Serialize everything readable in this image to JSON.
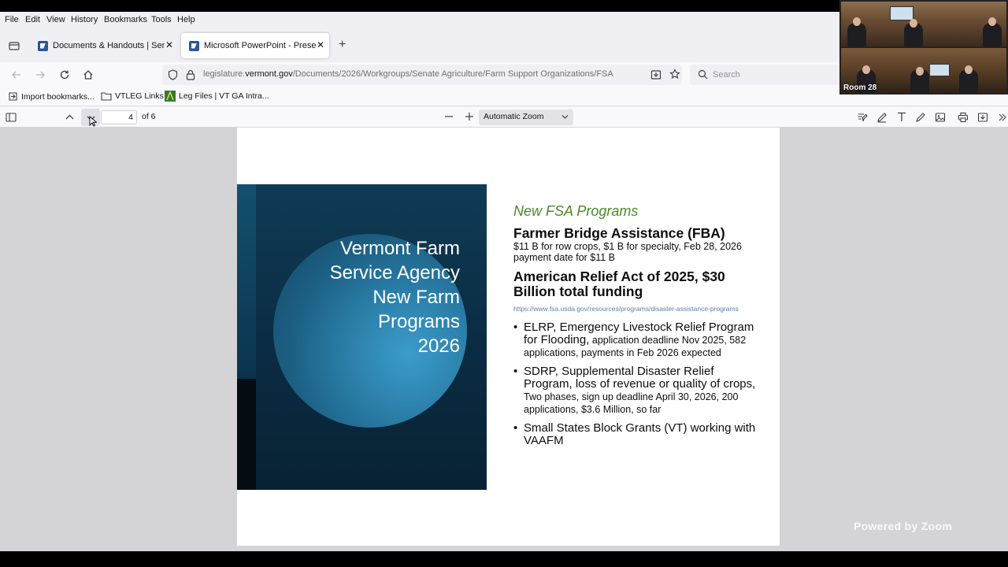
{
  "menu": [
    "File",
    "Edit",
    "View",
    "History",
    "Bookmarks",
    "Tools",
    "Help"
  ],
  "tabs": [
    {
      "title": "Documents & Handouts | Senate",
      "close": "✕"
    },
    {
      "title": "Microsoft PowerPoint - Presentation",
      "close": "✕"
    }
  ],
  "new_tab": "+",
  "url": {
    "prefix": "legislature.",
    "domain": "vermont.gov",
    "path": "/Documents/2026/Workgroups/Senate Agriculture/Farm Support Organizations/FSA"
  },
  "search_placeholder": "Search",
  "bookmarks": [
    "Import bookmarks...",
    "VTLEG Links",
    "Leg Files | VT GA Intra..."
  ],
  "pdf": {
    "page_number": "4",
    "page_count": "of 6",
    "zoom": "Automatic Zoom"
  },
  "slide": {
    "image_title": "Vermont Farm\nService Agency\nNew Farm\nPrograms\n2026",
    "subtitle": "New FSA Programs",
    "fba_heading": "Farmer Bridge Assistance (FBA)",
    "fba_text": "$11 B for row crops, $1 B for specialty, Feb 28, 2026 payment date for $11 B",
    "ara_heading": "American Relief Act of 2025, $30 Billion total funding",
    "link": "https://www.fsa.usda.gov/resources/programs/disaster-assistance-programs",
    "bullets": [
      {
        "large": "ELRP, Emergency Livestock Relief Program for Flooding,",
        "small": " application deadline Nov 2025, 582 applications, payments in Feb 2026 expected"
      },
      {
        "large": "SDRP, Supplemental Disaster Relief Program, loss of revenue or quality of crops,",
        "small": " Two phases, sign up deadline April 30, 2026, 200 applications, $3.6 Million, so far"
      },
      {
        "large": "Small States Block Grants (VT) working with VAAFM",
        "small": ""
      }
    ]
  },
  "video": {
    "room_label": "Room 28",
    "powered_by": "Powered by Zoom"
  }
}
